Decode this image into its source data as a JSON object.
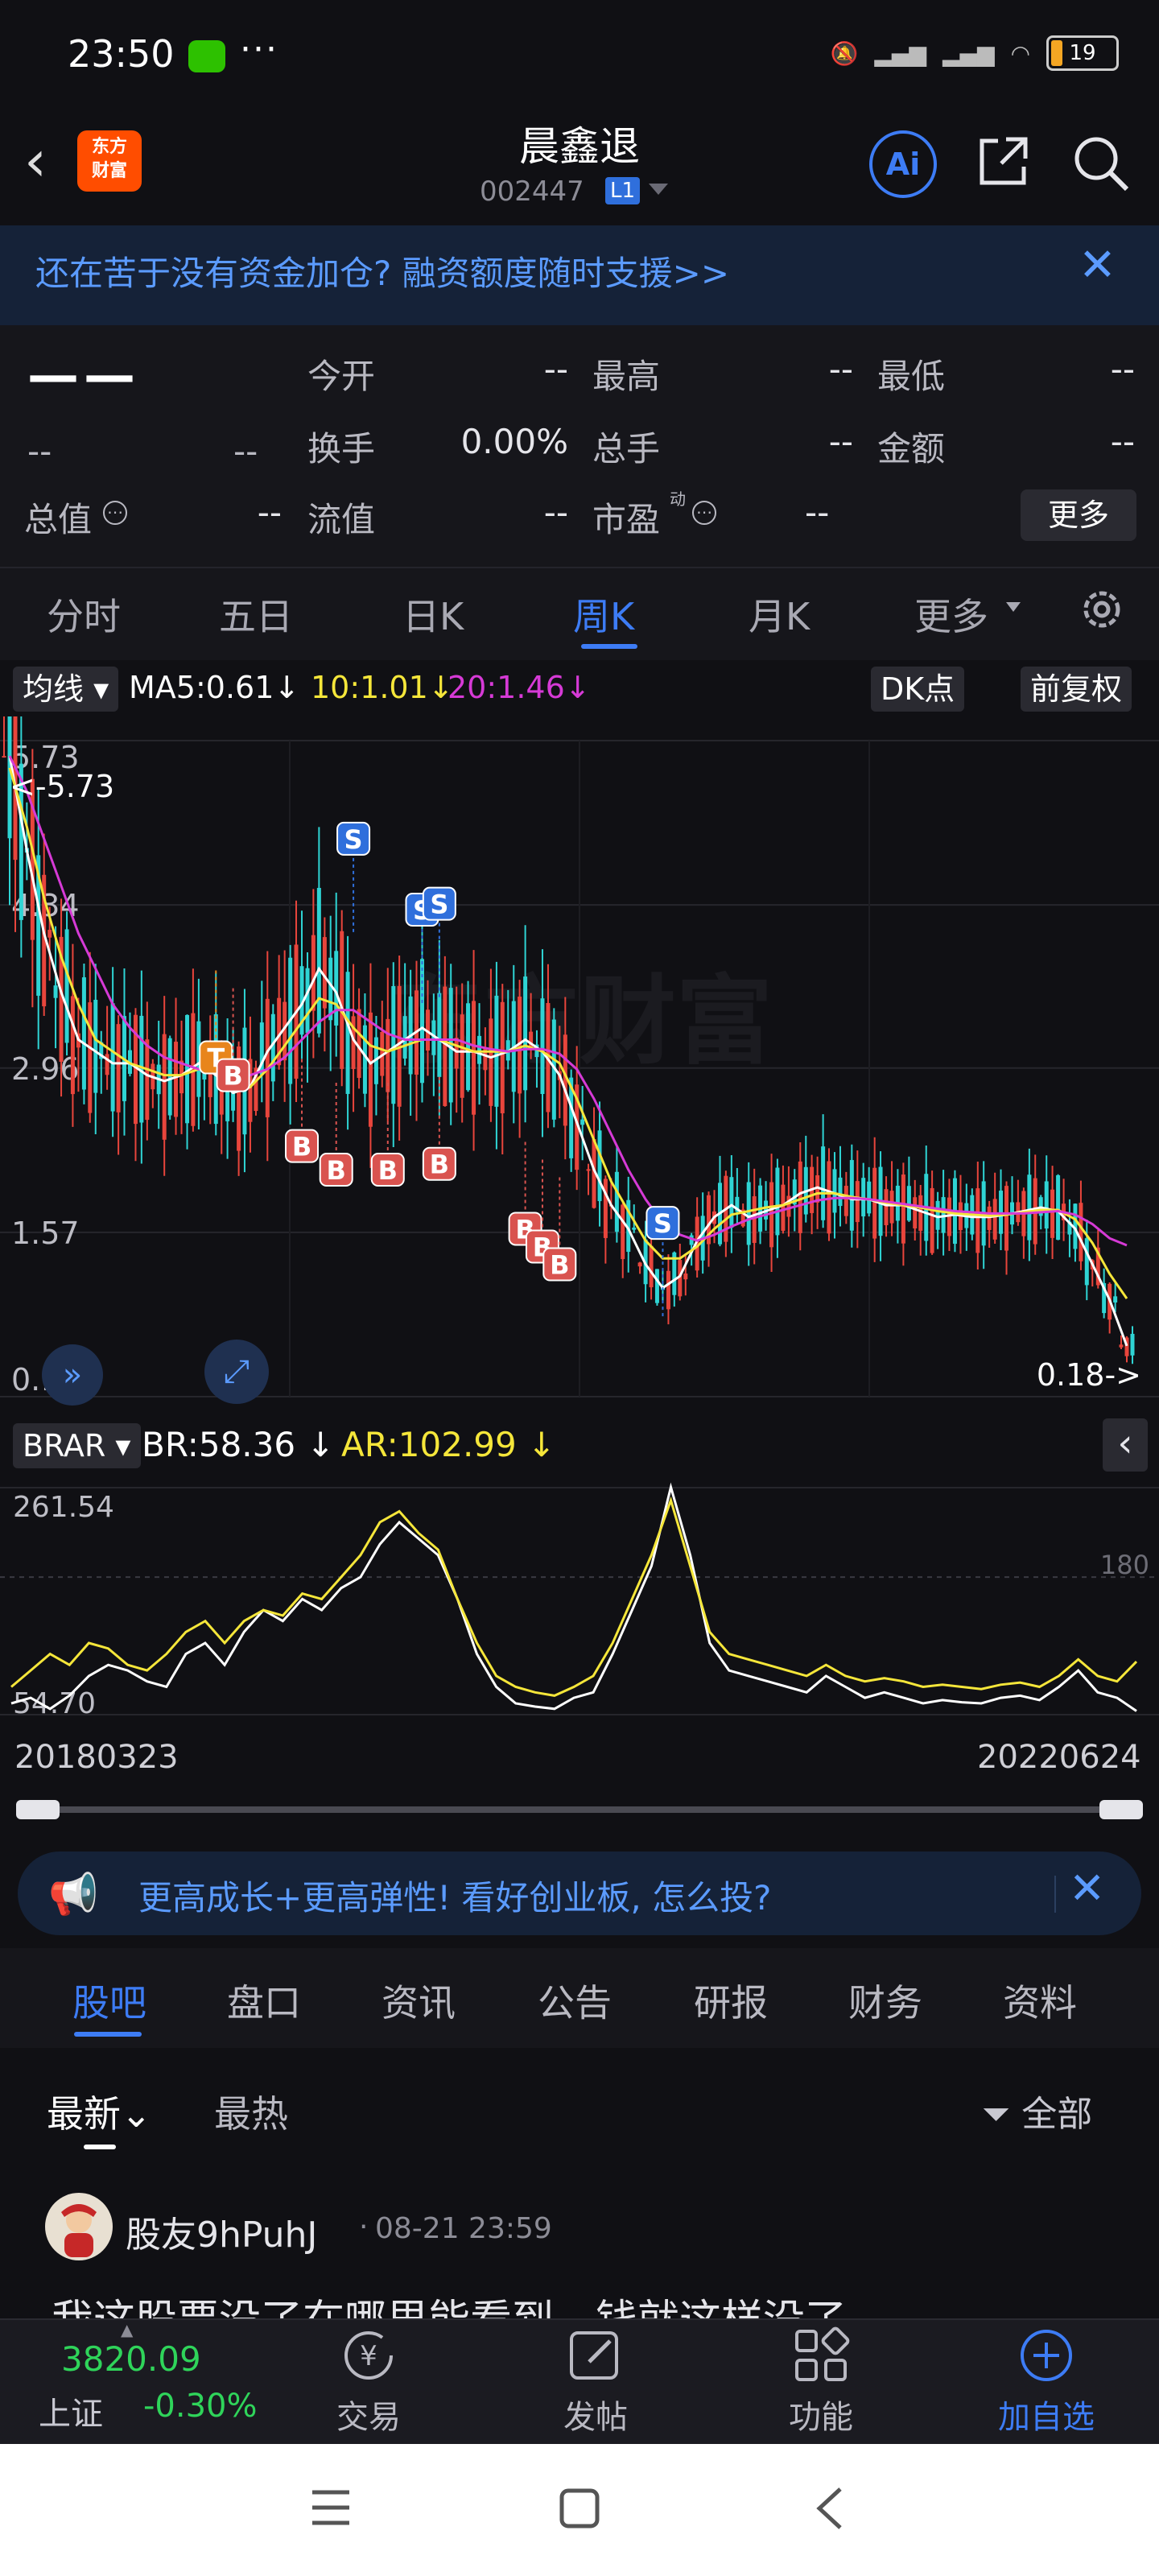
{
  "status_bar": {
    "time": "23:50",
    "more": "···",
    "battery": "19",
    "signal_6": "6"
  },
  "header": {
    "logo": "东方\n财富",
    "title": "晨鑫退",
    "code": "002447",
    "level": "L1",
    "ai": "Ai"
  },
  "banner": {
    "text": "还在苦于没有资金加仓? 融资额度随时支援>>",
    "close": "✕"
  },
  "quote": {
    "price": "——",
    "change_left": "--",
    "change_right": "--",
    "rows": [
      [
        {
          "label": "今开",
          "value": "--"
        },
        {
          "label": "最高",
          "value": "--"
        },
        {
          "label": "最低",
          "value": "--"
        }
      ],
      [
        {
          "label": "换手",
          "value": "0.00%"
        },
        {
          "label": "总手",
          "value": "--"
        },
        {
          "label": "金额",
          "value": "--"
        }
      ],
      [
        {
          "label": "流值",
          "value": "--"
        },
        {
          "label": "市盈",
          "value": "--"
        }
      ]
    ],
    "total_value_label": "总值",
    "total_value": "--",
    "pe_sup": "动",
    "more": "更多"
  },
  "ktabs": [
    "分时",
    "五日",
    "日K",
    "周K",
    "月K",
    "更多"
  ],
  "ktabs_active": "周K",
  "chart_toolbar": {
    "indicator": "均线",
    "ma5": "MA5:0.61",
    "ma10": "10:1.01",
    "ma20": "20:1.46",
    "dk": "DK点",
    "fq": "前复权"
  },
  "colors": {
    "ma5": "#ffffff",
    "ma10": "#f5e63a",
    "ma20": "#d63ad6",
    "up": "#e8453c",
    "down": "#2fd4d4",
    "accent": "#3d7cf5"
  },
  "chart_data": [
    {
      "type": "candlestick",
      "title": "",
      "y_ticks": [
        "5.73",
        "4.34",
        "2.96",
        "1.57",
        "0.18"
      ],
      "max_label": "<-5.73",
      "min_label": "0.18->",
      "series": [
        {
          "name": "MA5:0.61",
          "values": [
            5.6,
            4.8,
            4.1,
            3.6,
            3.2,
            3.1,
            3.0,
            3.0,
            2.9,
            2.85,
            2.9,
            3.0,
            2.9,
            2.75,
            2.8,
            3.1,
            3.3,
            3.5,
            3.8,
            3.6,
            3.2,
            3.0,
            3.1,
            3.2,
            3.3,
            3.2,
            3.1,
            3.1,
            3.05,
            3.1,
            3.2,
            3.1,
            2.9,
            2.5,
            2.1,
            1.8,
            1.6,
            1.3,
            1.1,
            1.2,
            1.5,
            1.7,
            1.8,
            1.7,
            1.75,
            1.8,
            1.9,
            1.95,
            1.9,
            1.85,
            1.85,
            1.8,
            1.8,
            1.75,
            1.7,
            1.72,
            1.7,
            1.7,
            1.72,
            1.75,
            1.78,
            1.75,
            1.6,
            1.3,
            1.0,
            0.61
          ]
        },
        {
          "name": "10:1.01",
          "values": [
            5.5,
            5.0,
            4.4,
            3.9,
            3.5,
            3.2,
            3.1,
            3.0,
            2.95,
            2.9,
            2.9,
            2.95,
            2.95,
            2.85,
            2.8,
            2.95,
            3.15,
            3.35,
            3.55,
            3.5,
            3.3,
            3.15,
            3.1,
            3.15,
            3.2,
            3.2,
            3.15,
            3.1,
            3.1,
            3.1,
            3.15,
            3.1,
            3.0,
            2.7,
            2.35,
            2.0,
            1.75,
            1.5,
            1.35,
            1.35,
            1.45,
            1.6,
            1.72,
            1.75,
            1.78,
            1.8,
            1.85,
            1.9,
            1.9,
            1.87,
            1.85,
            1.82,
            1.8,
            1.78,
            1.75,
            1.73,
            1.72,
            1.71,
            1.72,
            1.74,
            1.76,
            1.76,
            1.68,
            1.48,
            1.22,
            1.01
          ]
        },
        {
          "name": "20:1.46",
          "values": [
            5.6,
            5.3,
            4.9,
            4.5,
            4.1,
            3.8,
            3.5,
            3.3,
            3.15,
            3.05,
            3.0,
            2.95,
            2.95,
            2.95,
            2.9,
            2.95,
            3.05,
            3.2,
            3.35,
            3.45,
            3.45,
            3.35,
            3.25,
            3.2,
            3.2,
            3.2,
            3.2,
            3.15,
            3.12,
            3.1,
            3.12,
            3.12,
            3.08,
            2.95,
            2.7,
            2.4,
            2.1,
            1.85,
            1.65,
            1.55,
            1.5,
            1.55,
            1.62,
            1.68,
            1.72,
            1.76,
            1.8,
            1.84,
            1.86,
            1.86,
            1.85,
            1.83,
            1.81,
            1.79,
            1.77,
            1.75,
            1.74,
            1.73,
            1.73,
            1.73,
            1.74,
            1.75,
            1.72,
            1.64,
            1.52,
            1.46
          ]
        }
      ],
      "markers": [
        {
          "label": "S",
          "index": 20,
          "price": 4.9
        },
        {
          "label": "S",
          "index": 24,
          "price": 4.3
        },
        {
          "label": "S",
          "index": 25,
          "price": 4.35
        },
        {
          "label": "S",
          "index": 38,
          "price": 1.65
        },
        {
          "label": "T",
          "index": 12,
          "price": 3.05
        },
        {
          "label": "B",
          "index": 13,
          "price": 2.9
        },
        {
          "label": "B",
          "index": 17,
          "price": 2.3
        },
        {
          "label": "B",
          "index": 19,
          "price": 2.1
        },
        {
          "label": "B",
          "index": 22,
          "price": 2.1
        },
        {
          "label": "B",
          "index": 25,
          "price": 2.15
        },
        {
          "label": "B",
          "index": 30,
          "price": 1.6
        },
        {
          "label": "B",
          "index": 31,
          "price": 1.45
        },
        {
          "label": "B",
          "index": 32,
          "price": 1.3
        }
      ]
    },
    {
      "type": "line",
      "title": "",
      "indicator": "BRAR",
      "y_ticks": [
        "261.54",
        "54.70"
      ],
      "ref_line": "180",
      "x_start": "20180323",
      "x_end": "20220624",
      "series": [
        {
          "name": "BR:58.36",
          "values": [
            65,
            70,
            60,
            72,
            90,
            100,
            95,
            85,
            80,
            110,
            120,
            100,
            130,
            150,
            140,
            160,
            150,
            170,
            180,
            210,
            230,
            215,
            200,
            160,
            110,
            80,
            65,
            62,
            60,
            70,
            75,
            110,
            150,
            190,
            262,
            200,
            120,
            95,
            90,
            85,
            80,
            75,
            90,
            80,
            70,
            75,
            70,
            65,
            68,
            66,
            65,
            70,
            72,
            68,
            80,
            95,
            75,
            70,
            58
          ]
        },
        {
          "name": "AR:102.99",
          "values": [
            80,
            95,
            110,
            100,
            120,
            115,
            100,
            95,
            110,
            130,
            140,
            120,
            140,
            150,
            145,
            165,
            160,
            180,
            200,
            230,
            240,
            220,
            205,
            160,
            120,
            90,
            80,
            75,
            72,
            80,
            90,
            120,
            160,
            200,
            250,
            190,
            130,
            110,
            105,
            100,
            95,
            90,
            100,
            90,
            85,
            88,
            85,
            80,
            82,
            80,
            78,
            82,
            84,
            80,
            90,
            105,
            90,
            85,
            103
          ]
        }
      ]
    }
  ],
  "ad": {
    "text": "更高成长+更高弹性! 看好创业板, 怎么投?",
    "close": "✕"
  },
  "bottom_tabs": [
    "股吧",
    "盘口",
    "资讯",
    "公告",
    "研报",
    "财务",
    "资料"
  ],
  "bottom_tabs_active": "股吧",
  "sort": {
    "latest": "最新",
    "hot": "最热",
    "filter": "全部"
  },
  "post": {
    "user": "股友9hPuhJ",
    "time": "08-21 23:59",
    "text": "我这股票没了在哪里能看到，钱就这样没了"
  },
  "dock": {
    "index_value": "3820.09",
    "index_name": "上证",
    "index_change": "-0.30%",
    "trade": "交易",
    "post": "发帖",
    "function": "功能",
    "add": "加自选"
  }
}
